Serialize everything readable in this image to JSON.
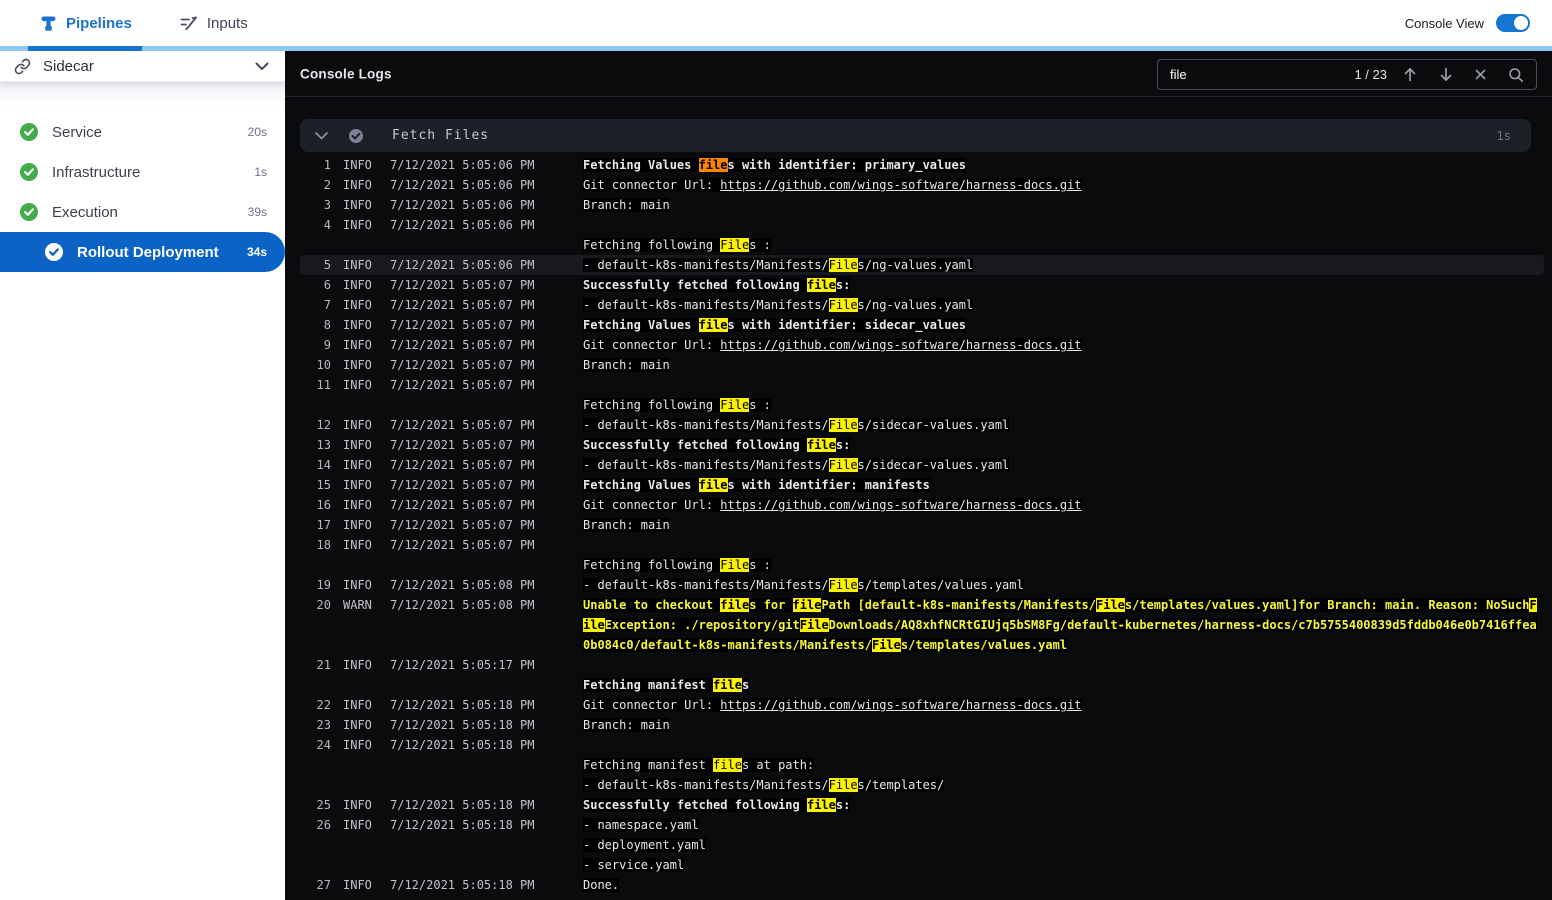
{
  "topbar": {
    "tabs": [
      {
        "label": "Pipelines",
        "active": true
      },
      {
        "label": "Inputs",
        "active": false
      }
    ],
    "console_view_label": "Console View",
    "console_view_on": true
  },
  "sidebar": {
    "title": "Sidecar",
    "items": [
      {
        "label": "Service",
        "duration": "20s",
        "status": "success",
        "selected": false
      },
      {
        "label": "Infrastructure",
        "duration": "1s",
        "status": "success",
        "selected": false
      },
      {
        "label": "Execution",
        "duration": "39s",
        "status": "success",
        "selected": false
      },
      {
        "label": "Rollout Deployment",
        "duration": "34s",
        "status": "success",
        "selected": true
      }
    ]
  },
  "console": {
    "title": "Console Logs",
    "search": {
      "value": "file",
      "match_count": "1 / 23"
    },
    "section": {
      "title": "Fetch Files",
      "duration": "1s"
    },
    "logs": [
      {
        "n": 1,
        "level": "INFO",
        "time": "7/12/2021 5:05:06 PM",
        "bold": true,
        "msg": "Fetching Values files with identifier: primary_values"
      },
      {
        "n": 2,
        "level": "INFO",
        "time": "7/12/2021 5:05:06 PM",
        "msg": "Git connector Url: https://github.com/wings-software/harness-docs.git"
      },
      {
        "n": 3,
        "level": "INFO",
        "time": "7/12/2021 5:05:06 PM",
        "msg": "Branch: main"
      },
      {
        "n": 4,
        "level": "INFO",
        "time": "7/12/2021 5:05:06 PM",
        "msg": "\nFetching following Files :"
      },
      {
        "n": 5,
        "level": "INFO",
        "time": "7/12/2021 5:05:06 PM",
        "selected": true,
        "msg": "- default-k8s-manifests/Manifests/Files/ng-values.yaml"
      },
      {
        "n": 6,
        "level": "INFO",
        "time": "7/12/2021 5:05:07 PM",
        "bold": true,
        "msg": "Successfully fetched following files:"
      },
      {
        "n": 7,
        "level": "INFO",
        "time": "7/12/2021 5:05:07 PM",
        "msg": "- default-k8s-manifests/Manifests/Files/ng-values.yaml"
      },
      {
        "n": 8,
        "level": "INFO",
        "time": "7/12/2021 5:05:07 PM",
        "bold": true,
        "msg": "Fetching Values files with identifier: sidecar_values"
      },
      {
        "n": 9,
        "level": "INFO",
        "time": "7/12/2021 5:05:07 PM",
        "msg": "Git connector Url: https://github.com/wings-software/harness-docs.git"
      },
      {
        "n": 10,
        "level": "INFO",
        "time": "7/12/2021 5:05:07 PM",
        "msg": "Branch: main"
      },
      {
        "n": 11,
        "level": "INFO",
        "time": "7/12/2021 5:05:07 PM",
        "msg": "\nFetching following Files :"
      },
      {
        "n": 12,
        "level": "INFO",
        "time": "7/12/2021 5:05:07 PM",
        "msg": "- default-k8s-manifests/Manifests/Files/sidecar-values.yaml"
      },
      {
        "n": 13,
        "level": "INFO",
        "time": "7/12/2021 5:05:07 PM",
        "bold": true,
        "msg": "Successfully fetched following files:"
      },
      {
        "n": 14,
        "level": "INFO",
        "time": "7/12/2021 5:05:07 PM",
        "msg": "- default-k8s-manifests/Manifests/Files/sidecar-values.yaml"
      },
      {
        "n": 15,
        "level": "INFO",
        "time": "7/12/2021 5:05:07 PM",
        "bold": true,
        "msg": "Fetching Values files with identifier: manifests"
      },
      {
        "n": 16,
        "level": "INFO",
        "time": "7/12/2021 5:05:07 PM",
        "msg": "Git connector Url: https://github.com/wings-software/harness-docs.git"
      },
      {
        "n": 17,
        "level": "INFO",
        "time": "7/12/2021 5:05:07 PM",
        "msg": "Branch: main"
      },
      {
        "n": 18,
        "level": "INFO",
        "time": "7/12/2021 5:05:07 PM",
        "msg": "\nFetching following Files :"
      },
      {
        "n": 19,
        "level": "INFO",
        "time": "7/12/2021 5:05:08 PM",
        "msg": "- default-k8s-manifests/Manifests/Files/templates/values.yaml"
      },
      {
        "n": 20,
        "level": "WARN",
        "time": "7/12/2021 5:05:08 PM",
        "bold": true,
        "warn": true,
        "msg": "Unable to checkout files for filePath [default-k8s-manifests/Manifests/Files/templates/values.yaml]for Branch: main. Reason: NoSuchF\nileException: ./repository/gitFileDownloads/AQ8xhfNCRtGIUjq5bSM8Fg/default-kubernetes/harness-docs/c7b5755400839d5fddb046e0b7416ffea\n0b084c0/default-k8s-manifests/Manifests/Files/templates/values.yaml"
      },
      {
        "n": 21,
        "level": "INFO",
        "time": "7/12/2021 5:05:17 PM",
        "bold": true,
        "msg": "\nFetching manifest files"
      },
      {
        "n": 22,
        "level": "INFO",
        "time": "7/12/2021 5:05:18 PM",
        "msg": "Git connector Url: https://github.com/wings-software/harness-docs.git"
      },
      {
        "n": 23,
        "level": "INFO",
        "time": "7/12/2021 5:05:18 PM",
        "msg": "Branch: main"
      },
      {
        "n": 24,
        "level": "INFO",
        "time": "7/12/2021 5:05:18 PM",
        "msg": "\nFetching manifest files at path:\n- default-k8s-manifests/Manifests/Files/templates/"
      },
      {
        "n": 25,
        "level": "INFO",
        "time": "7/12/2021 5:05:18 PM",
        "bold": true,
        "msg": "Successfully fetched following files:"
      },
      {
        "n": 26,
        "level": "INFO",
        "time": "7/12/2021 5:05:18 PM",
        "msg": "- namespace.yaml\n- deployment.yaml\n- service.yaml"
      },
      {
        "n": 27,
        "level": "INFO",
        "time": "7/12/2021 5:05:18 PM",
        "msg": "Done."
      }
    ]
  },
  "colors": {
    "accent_blue": "#1575d0",
    "selected_row_blue": "#0b63c5",
    "strip_light_blue": "#8cc9ef",
    "success_green": "#42ab4a",
    "search_highlight": "#fbf104",
    "current_match_orange": "#fb8500",
    "warn_yellow": "#f6f63c",
    "console_bg": "#0a0b0d"
  }
}
